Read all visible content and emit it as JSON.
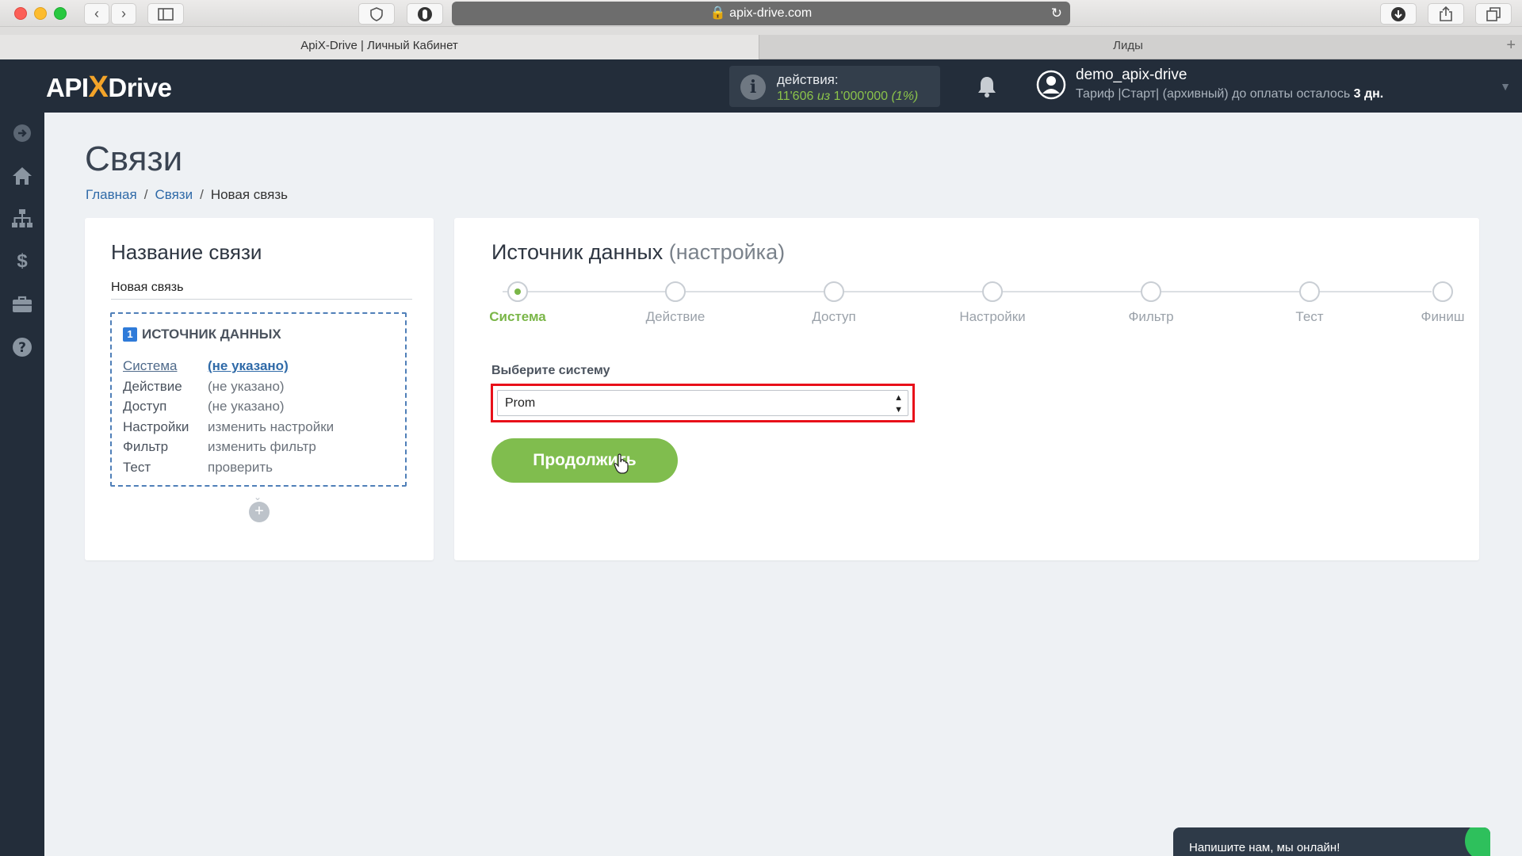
{
  "browser": {
    "url": "apix-drive.com",
    "tabs": [
      {
        "label": "ApiX-Drive | Личный Кабинет"
      },
      {
        "label": "Лиды"
      }
    ]
  },
  "header": {
    "logo_api": "API",
    "logo_x": "X",
    "logo_drive": "Drive",
    "actions_label": "действия:",
    "actions_used": "11'606",
    "actions_of": "из",
    "actions_total": "1'000'000",
    "actions_pct": "(1%)",
    "username": "demo_apix-drive",
    "plan_text": "Тариф |Старт| (архивный) до оплаты осталось",
    "plan_days": "3 дн."
  },
  "page": {
    "title": "Связи",
    "breadcrumb": [
      "Главная",
      "Связи",
      "Новая связь"
    ]
  },
  "left_card": {
    "title": "Название связи",
    "name_value": "Новая связь",
    "source_num": "1",
    "source_title": "ИСТОЧНИК ДАННЫХ",
    "rows": [
      {
        "key": "Система",
        "value": "(не указано)"
      },
      {
        "key": "Действие",
        "value": "(не указано)"
      },
      {
        "key": "Доступ",
        "value": "(не указано)"
      },
      {
        "key": "Настройки",
        "value": "изменить настройки"
      },
      {
        "key": "Фильтр",
        "value": "изменить фильтр"
      },
      {
        "key": "Тест",
        "value": "проверить"
      }
    ],
    "add_symbol": "+"
  },
  "right_card": {
    "title": "Источник данных",
    "subtitle": "(настройка)",
    "steps": [
      "Система",
      "Действие",
      "Доступ",
      "Настройки",
      "Фильтр",
      "Тест",
      "Финиш"
    ],
    "select_label": "Выберите систему",
    "select_value": "Prom",
    "continue_label": "Продолжить"
  },
  "chat": {
    "label": "Напишите нам, мы онлайн!"
  },
  "colors": {
    "accent_green": "#80bd4e",
    "header_bg": "#232d3a",
    "highlight_red": "#e8101a"
  }
}
